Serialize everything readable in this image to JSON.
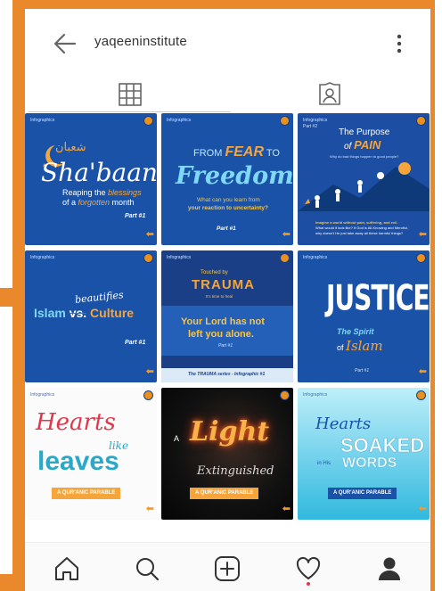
{
  "profile": {
    "username": "yaqeeninstitute"
  },
  "icons": {
    "back": "arrow-left-icon",
    "more": "more-vertical-icon",
    "grid": "grid-icon",
    "tagged": "tagged-portrait-icon",
    "home": "home-icon",
    "search": "search-icon",
    "add": "add-post-icon",
    "activity": "heart-icon",
    "profile": "profile-icon"
  },
  "colors": {
    "accent": "#e9892b",
    "tile_blue": "#1a52a8",
    "notification_dot": "#e2374b"
  },
  "posts": [
    {
      "tag": "Infographics",
      "title": "Sha'baan",
      "script": "شعبان",
      "subtitle_a": "Reaping the ",
      "subtitle_em": "blessings",
      "subtitle_b": "of a ",
      "subtitle_em2": "forgotten",
      "subtitle_c": " month",
      "part": "Part #1"
    },
    {
      "tag": "Infographics",
      "line1_a": "FROM ",
      "line1_em": "FEAR",
      "line1_b": " TO",
      "title": "Freedom",
      "question": "What can you learn from",
      "question2": "your reaction to uncertainty?",
      "part": "Part #1"
    },
    {
      "tag": "Infographics",
      "subtag": "Part #2",
      "title_a": "The Purpose",
      "title_b": "of ",
      "title_em": "PAIN",
      "question": "Why do bad things happen to good people?",
      "footnote": "Imagine a world without pain, suffering, and evil.",
      "footnote2": "What would it look like? If God is All-Knowing and Merciful,",
      "footnote3": "why doesn't He just take away all these harmful things?"
    },
    {
      "tag": "Infographics",
      "script": "beautifies",
      "title_a": "Islam ",
      "title_vs": "vs.",
      "title_b": " Culture",
      "part": "Part #1"
    },
    {
      "tag": "Infographics",
      "pre": "Touched by",
      "title": "TRAUMA",
      "sub": "It's time to heal",
      "message": "Your Lord has not",
      "message2": "left you alone.",
      "part": "Part #1",
      "series": "The TRAUMA series - Infographic #1"
    },
    {
      "tag": "Infographics",
      "title": "JUSTICE",
      "sub_a": "The Spirit",
      "sub_b": "of ",
      "sub_em": "Islam",
      "part": "Part #1"
    },
    {
      "tag": "Infographics",
      "title_a": "Hearts",
      "title_b": "like",
      "title_c": "leaves",
      "ribbon": "A QUR'ANIC PARABLE"
    },
    {
      "tag": "",
      "pre": "A",
      "title": "Light",
      "sub": "Extinguished",
      "ribbon": "A QUR'ANIC PARABLE"
    },
    {
      "tag": "Infographics",
      "title_a": "Hearts",
      "title_b": "SOAKED",
      "title_c": "in His",
      "title_d": "WORDS",
      "ribbon": "A QUR'ANIC PARABLE"
    }
  ]
}
